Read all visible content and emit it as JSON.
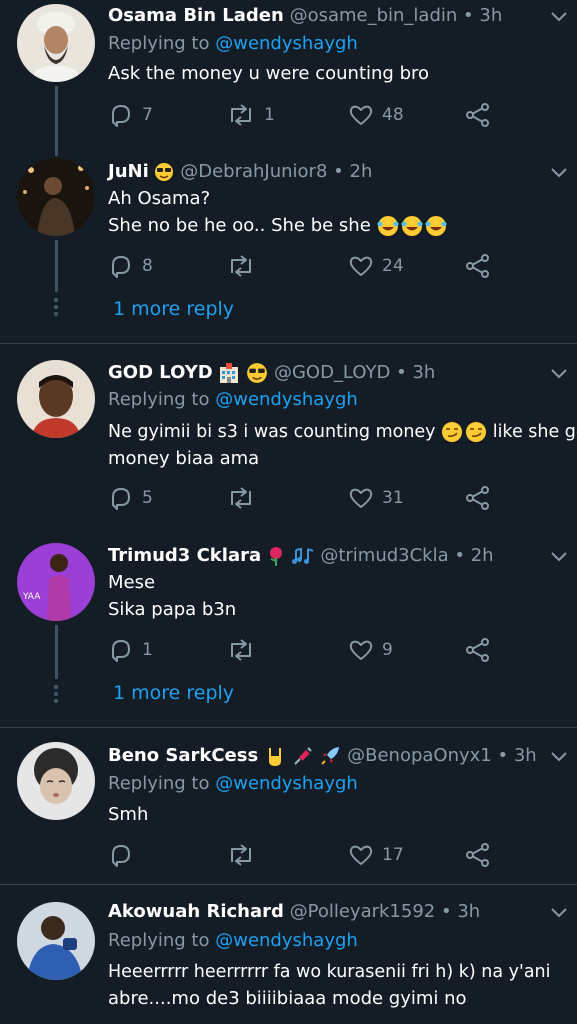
{
  "colors": {
    "background": "#141d26",
    "link": "#1da1f2",
    "muted": "#8899a6",
    "separator": "#38444d"
  },
  "tweets": [
    {
      "name": "Osama Bin Laden",
      "handle": "@osame_bin_ladin",
      "time": "3h",
      "replying_label": "Replying to",
      "replying_handle": "@wendyshaygh",
      "lines": [
        "Ask the money u were counting bro"
      ],
      "reply_count": "7",
      "retweet_count": "1",
      "like_count": "48"
    },
    {
      "name": "JuNi",
      "handle": "@DebrahJunior8",
      "time": "2h",
      "lines": [
        "Ah Osama?",
        "She no be he oo.. She be she"
      ],
      "reply_count": "8",
      "retweet_count": "",
      "like_count": "24",
      "more_replies": "1 more reply"
    },
    {
      "name": "GOD LOYD",
      "handle": "@GOD_LOYD",
      "time": "3h",
      "replying_label": "Replying to",
      "replying_handle": "@wendyshaygh",
      "lines": [
        "Ne gyimii bi s3 i was counting money",
        "like she get",
        "money biaa ama"
      ],
      "reply_count": "5",
      "retweet_count": "",
      "like_count": "31"
    },
    {
      "name": "Trimud3 Cklara",
      "handle": "@trimud3Ckla",
      "time": "2h",
      "lines": [
        "Mese",
        "Sika papa b3n"
      ],
      "avatar_text": "YAA",
      "reply_count": "1",
      "retweet_count": "",
      "like_count": "9",
      "more_replies": "1 more reply"
    },
    {
      "name": "Beno SarkCess",
      "handle": "@BenopaOnyx1",
      "time": "3h",
      "replying_label": "Replying to",
      "replying_handle": "@wendyshaygh",
      "lines": [
        "Smh"
      ],
      "reply_count": "",
      "retweet_count": "",
      "like_count": "17"
    },
    {
      "name": "Akowuah Richard",
      "handle": "@Polleyark1592",
      "time": "3h",
      "replying_label": "Replying to",
      "replying_handle": "@wendyshaygh",
      "lines": [
        "Heeerrrrr heerrrrrr fa wo kurasenii fri h) k) na y'ani",
        "abre....mo de3 biiiibiaaa mode gyimi no"
      ]
    }
  ]
}
